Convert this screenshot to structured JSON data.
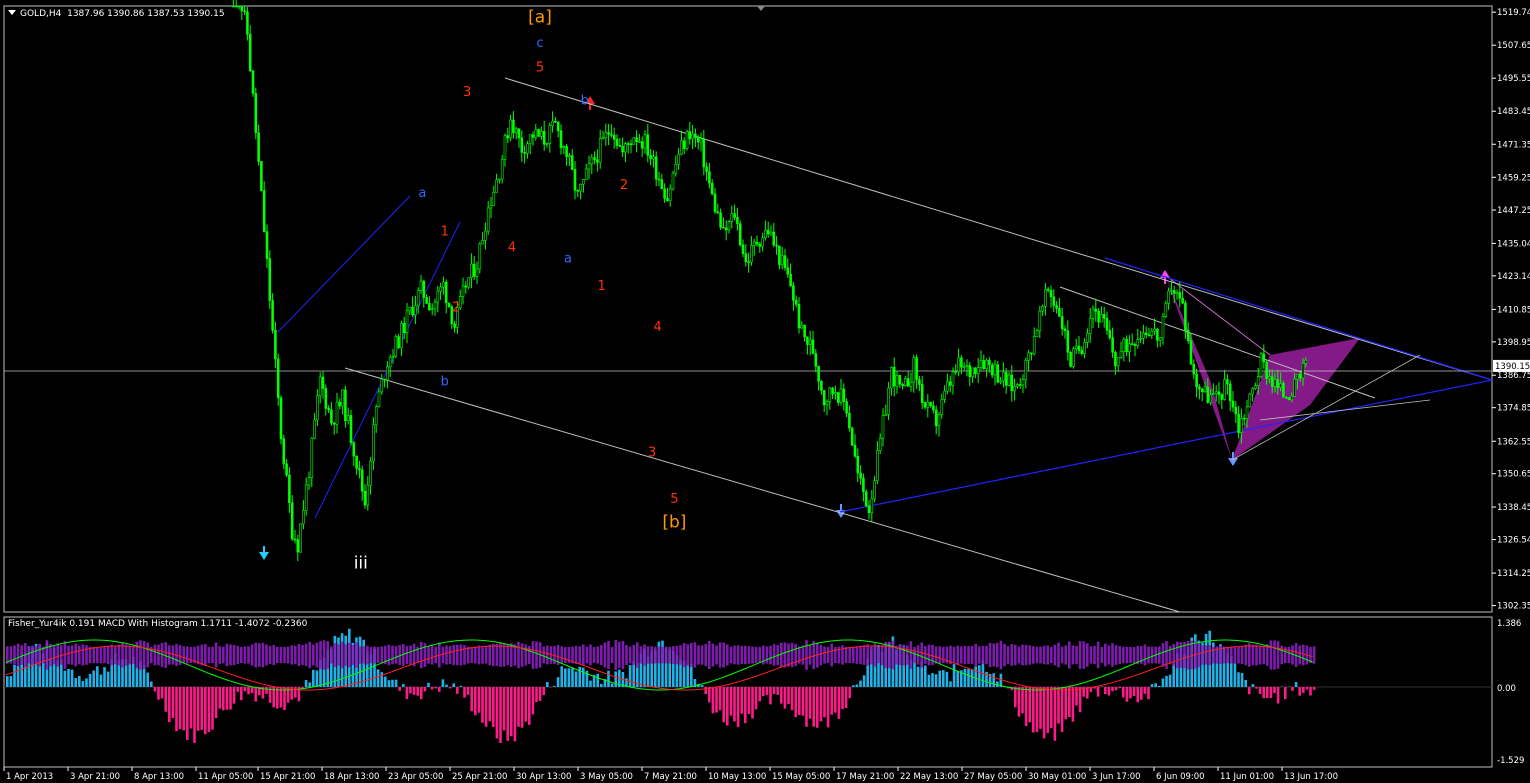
{
  "header": {
    "symbol": "GOLD,H4",
    "ohlc": "1387.96 1390.86 1387.53 1390.15"
  },
  "indicator": {
    "label": "Fisher_Yur4ik 0.191  MACD With Histogram 1.1711 -1.4072 -0.2360"
  },
  "colors": {
    "candle": "#00ff00",
    "axis": "#ffffff",
    "trend_blue": "#2222ff",
    "channel": "#c0c0c0",
    "pattern": "#9b1fa0",
    "hist_pos": "#1fb1e8",
    "hist_neg": "#ff1a8c",
    "hist_purple": "#8a1fbf",
    "macd_line": "#00ff00",
    "signal_line": "#ff2020",
    "orange": "#ff9900",
    "red": "#ff3300",
    "wave_blue": "#3366ff"
  },
  "chart_data": {
    "type": "candlestick",
    "symbol": "GOLD",
    "timeframe": "H4",
    "current_price": "1390.15",
    "ylim": [
      1300.0,
      1522.0
    ],
    "price_ticks": [
      "1519.74",
      "1507.65",
      "1495.55",
      "1483.45",
      "1471.35",
      "1459.25",
      "1447.25",
      "1435.04",
      "1423.14",
      "1410.85",
      "1398.95",
      "1386.75",
      "1374.85",
      "1362.55",
      "1350.65",
      "1338.45",
      "1326.54",
      "1314.25",
      "1302.35"
    ],
    "time_ticks": [
      "1 Apr 2013",
      "3 Apr 21:00",
      "8 Apr 13:00",
      "11 Apr 05:00",
      "15 Apr 21:00",
      "18 Apr 13:00",
      "23 Apr 05:00",
      "25 Apr 21:00",
      "30 Apr 13:00",
      "3 May 05:00",
      "7 May 21:00",
      "10 May 13:00",
      "15 May 05:00",
      "17 May 21:00",
      "22 May 13:00",
      "27 May 05:00",
      "30 May 01:00",
      "3 Jun 17:00",
      "6 Jun 09:00",
      "11 Jun 01:00",
      "13 Jun 17:00"
    ],
    "price_path": [
      [
        0,
        1540
      ],
      [
        3,
        1512
      ],
      [
        6,
        1440
      ],
      [
        9,
        1365
      ],
      [
        11,
        1330
      ],
      [
        12,
        1325
      ],
      [
        14,
        1352
      ],
      [
        16,
        1385
      ],
      [
        18,
        1370
      ],
      [
        20,
        1378
      ],
      [
        22,
        1360
      ],
      [
        24,
        1340
      ],
      [
        26,
        1375
      ],
      [
        28,
        1392
      ],
      [
        30,
        1400
      ],
      [
        32,
        1410
      ],
      [
        34,
        1418
      ],
      [
        36,
        1412
      ],
      [
        38,
        1420
      ],
      [
        40,
        1405
      ],
      [
        42,
        1420
      ],
      [
        44,
        1428
      ],
      [
        46,
        1448
      ],
      [
        48,
        1462
      ],
      [
        50,
        1481
      ],
      [
        52,
        1470
      ],
      [
        54,
        1475
      ],
      [
        56,
        1473
      ],
      [
        58,
        1478
      ],
      [
        60,
        1468
      ],
      [
        62,
        1452
      ],
      [
        64,
        1462
      ],
      [
        66,
        1470
      ],
      [
        68,
        1478
      ],
      [
        70,
        1468
      ],
      [
        72,
        1475
      ],
      [
        74,
        1472
      ],
      [
        76,
        1462
      ],
      [
        78,
        1452
      ],
      [
        80,
        1468
      ],
      [
        82,
        1476
      ],
      [
        84,
        1470
      ],
      [
        86,
        1452
      ],
      [
        88,
        1438
      ],
      [
        90,
        1446
      ],
      [
        92,
        1428
      ],
      [
        94,
        1436
      ],
      [
        96,
        1440
      ],
      [
        98,
        1430
      ],
      [
        100,
        1420
      ],
      [
        102,
        1402
      ],
      [
        104,
        1396
      ],
      [
        106,
        1378
      ],
      [
        108,
        1382
      ],
      [
        110,
        1375
      ],
      [
        112,
        1350
      ],
      [
        114,
        1338
      ],
      [
        116,
        1362
      ],
      [
        118,
        1388
      ],
      [
        120,
        1380
      ],
      [
        122,
        1390
      ],
      [
        124,
        1375
      ],
      [
        126,
        1370
      ],
      [
        128,
        1382
      ],
      [
        130,
        1390
      ],
      [
        132,
        1388
      ],
      [
        134,
        1393
      ],
      [
        136,
        1390
      ],
      [
        138,
        1385
      ],
      [
        140,
        1382
      ],
      [
        142,
        1390
      ],
      [
        144,
        1405
      ],
      [
        146,
        1418
      ],
      [
        148,
        1410
      ],
      [
        150,
        1392
      ],
      [
        152,
        1398
      ],
      [
        154,
        1412
      ],
      [
        156,
        1405
      ],
      [
        158,
        1392
      ],
      [
        160,
        1398
      ],
      [
        162,
        1402
      ],
      [
        164,
        1404
      ],
      [
        166,
        1400
      ],
      [
        168,
        1420
      ],
      [
        170,
        1412
      ],
      [
        172,
        1386
      ],
      [
        174,
        1380
      ],
      [
        176,
        1378
      ],
      [
        178,
        1384
      ],
      [
        180,
        1368
      ],
      [
        182,
        1378
      ],
      [
        184,
        1392
      ],
      [
        186,
        1385
      ],
      [
        188,
        1380
      ],
      [
        190,
        1382
      ],
      [
        192,
        1390
      ]
    ],
    "annotations": [
      {
        "text": "[a]",
        "color": "orange",
        "i": 55,
        "p": 1516
      },
      {
        "text": "c",
        "color": "wave_blue",
        "i": 55,
        "p": 1507
      },
      {
        "text": "5",
        "color": "red",
        "i": 55,
        "p": 1498
      },
      {
        "text": "b",
        "color": "wave_blue",
        "i": 63,
        "p": 1486
      },
      {
        "text": "a",
        "color": "wave_blue",
        "i": 34,
        "p": 1452
      },
      {
        "text": "b",
        "color": "wave_blue",
        "i": 38,
        "p": 1383
      },
      {
        "text": "a",
        "color": "wave_blue",
        "i": 60,
        "p": 1428
      },
      {
        "text": "iii",
        "color": "white",
        "i": 23,
        "p": 1316
      },
      {
        "text": "[b]",
        "color": "orange",
        "i": 79,
        "p": 1331
      },
      {
        "text": "5",
        "color": "red",
        "i": 79,
        "p": 1340
      },
      {
        "text": "3",
        "color": "red",
        "i": 42,
        "p": 1489
      },
      {
        "text": "1",
        "color": "red",
        "i": 38,
        "p": 1438
      },
      {
        "text": "2",
        "color": "red",
        "i": 40,
        "p": 1410
      },
      {
        "text": "4",
        "color": "red",
        "i": 50,
        "p": 1432
      },
      {
        "text": "2",
        "color": "red",
        "i": 70,
        "p": 1455
      },
      {
        "text": "1",
        "color": "red",
        "i": 66,
        "p": 1418
      },
      {
        "text": "4",
        "color": "red",
        "i": 76,
        "p": 1403
      },
      {
        "text": "3",
        "color": "red",
        "i": 75,
        "p": 1357
      }
    ]
  }
}
